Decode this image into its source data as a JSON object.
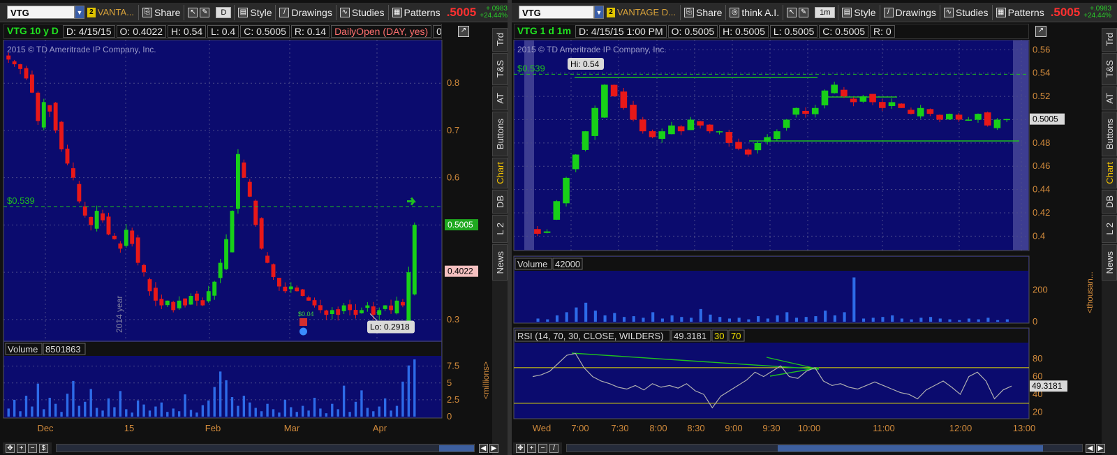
{
  "left": {
    "toolbar": {
      "symbol": "VTG",
      "link_badge": "2",
      "desc": "VANTA...",
      "share": "Share",
      "agg": "D",
      "style": "Style",
      "drawings": "Drawings",
      "studies": "Studies",
      "patterns": "Patterns",
      "last": ".5005",
      "change_abs": "+.0983",
      "change_pct": "+24.44%"
    },
    "header": {
      "symbol": "VTG 10 y D",
      "date": "D: 4/15/15",
      "open": "O: 0.4022",
      "high": "H: 0.54",
      "low": "L: 0.4",
      "close": "C: 0.5005",
      "range": "R: 0.14",
      "study": "DailyOpen (DAY, yes)",
      "study_value": "0.4022"
    },
    "copyright": "2015 © TD Ameritrade IP Company, Inc.",
    "alert_label": "$0.539",
    "hi_lo_label": "Lo: 0.2918",
    "event_label": "$0.04",
    "year_label": "2014 year",
    "price_axis": [
      "0.8",
      "0.7",
      "0.6",
      "0.5",
      "0.4",
      "0.3"
    ],
    "price_tag_last": "0.5005",
    "price_tag_open": "0.4022",
    "volume_label": "Volume",
    "volume_value": "8501863",
    "volume_axis": [
      "7.5",
      "5",
      "2.5",
      "0"
    ],
    "volume_unit": "<millions>",
    "x_axis": [
      "Dec",
      "15",
      "Feb",
      "Mar",
      "Apr"
    ]
  },
  "right": {
    "toolbar": {
      "symbol": "VTG",
      "link_badge": "2",
      "desc": "VANTAGE D...",
      "share": "Share",
      "thinkai": "think A.I.",
      "agg": "1m",
      "style": "Style",
      "drawings": "Drawings",
      "studies": "Studies",
      "patterns": "Patterns",
      "last": ".5005",
      "change_abs": "+.0983",
      "change_pct": "+24.44%"
    },
    "header": {
      "symbol": "VTG 1 d 1m",
      "date": "D: 4/15/15 1:00 PM",
      "open": "O: 0.5005",
      "high": "H: 0.5005",
      "low": "L: 0.5005",
      "close": "C: 0.5005",
      "range": "R: 0"
    },
    "copyright": "2015 © TD Ameritrade IP Company, Inc.",
    "alert_label": "$0.539",
    "hi_label": "Hi: 0.54",
    "price_axis": [
      "0.56",
      "0.54",
      "0.52",
      "0.5",
      "0.48",
      "0.46",
      "0.44",
      "0.42",
      "0.4"
    ],
    "price_tag_last": "0.5005",
    "volume_label": "Volume",
    "volume_value": "42000",
    "volume_axis": [
      "200",
      "0"
    ],
    "volume_unit": "<thousan...",
    "rsi_label": "RSI (14, 70, 30, CLOSE, WILDERS)",
    "rsi_value": "49.3181",
    "rsi_low": "30",
    "rsi_high": "70",
    "rsi_axis": [
      "80",
      "60",
      "40",
      "20"
    ],
    "rsi_tag": "49.3181",
    "x_axis": [
      "Wed",
      "7:00",
      "7:30",
      "8:00",
      "8:30",
      "9:00",
      "9:30",
      "10:00",
      "11:00",
      "12:00",
      "13:00"
    ]
  },
  "sidebar_tabs": [
    "Trd",
    "T&S",
    "AT",
    "Buttons",
    "Chart",
    "DB",
    "L 2",
    "News"
  ],
  "colors": {
    "chart_bg": "#0b0b6e",
    "up": "#18d018",
    "down": "#e81818",
    "alert_line": "#1fc01f",
    "volume": "#2d6be8",
    "rsi": "#b0b0b0",
    "rsi_band": "#e8e000"
  },
  "chart_data": [
    {
      "type": "candlestick",
      "title": "VTG 10 y D",
      "x": [
        "Dec",
        "15",
        "Feb",
        "Mar",
        "Apr"
      ],
      "ylim": [
        0.26,
        0.88
      ],
      "alert_level": 0.539,
      "series": [
        {
          "values": [
            0.85,
            0.84,
            0.83,
            0.81,
            0.78,
            0.72,
            0.76,
            0.74,
            0.7,
            0.66,
            0.63,
            0.6,
            0.55,
            0.52,
            0.5,
            0.53,
            0.51,
            0.48,
            0.47,
            0.45,
            0.49,
            0.46,
            0.42,
            0.4,
            0.36,
            0.34,
            0.33,
            0.34,
            0.32,
            0.34,
            0.33,
            0.35,
            0.34,
            0.33,
            0.36,
            0.38,
            0.42,
            0.47,
            0.53,
            0.65,
            0.6,
            0.56,
            0.5,
            0.45,
            0.42,
            0.39,
            0.37,
            0.36,
            0.37,
            0.36,
            0.35,
            0.34,
            0.33,
            0.32,
            0.31,
            0.32,
            0.31,
            0.33,
            0.32,
            0.31,
            0.32,
            0.33,
            0.31,
            0.32,
            0.33,
            0.32,
            0.34,
            0.33,
            0.4,
            0.5005
          ]
        }
      ]
    },
    {
      "type": "bar",
      "title": "Volume",
      "ylim": [
        0,
        8.5
      ],
      "series": [
        {
          "values": [
            1.2,
            2.5,
            0.8,
            3.1,
            1.5,
            4.9,
            1.1,
            2.8,
            1.9,
            0.7,
            3.4,
            5.3,
            1.6,
            2.2,
            4.1,
            1.3,
            0.9,
            2.7,
            1.4,
            3.8,
            1.1,
            0.6,
            2.4,
            1.8,
            0.9,
            1.5,
            2.1,
            0.7,
            1.2,
            0.8,
            3.3,
            1.0,
            0.6,
            1.7,
            2.4,
            4.4,
            6.7,
            5.4,
            2.9,
            1.6,
            3.1,
            2.1,
            1.3,
            0.8,
            1.9,
            1.1,
            0.6,
            2.5,
            1.4,
            0.7,
            1.6,
            0.9,
            2.8,
            1.2,
            0.5,
            1.9,
            1.1,
            4.6,
            0.7,
            2.2,
            3.9,
            1.3,
            0.8,
            1.5,
            2.7,
            0.9,
            1.6,
            5.2,
            7.6,
            8.5
          ]
        }
      ]
    },
    {
      "type": "candlestick",
      "title": "VTG 1 d 1m",
      "x": [
        "Wed",
        "7:00",
        "7:30",
        "8:00",
        "8:30",
        "9:00",
        "9:30",
        "10:00",
        "11:00",
        "12:00",
        "13:00"
      ],
      "ylim": [
        0.39,
        0.565
      ],
      "alert_level": 0.539,
      "series": [
        {
          "values": [
            0.402,
            0.404,
            0.43,
            0.45,
            0.47,
            0.49,
            0.51,
            0.53,
            0.52,
            0.51,
            0.5,
            0.49,
            0.485,
            0.49,
            0.495,
            0.49,
            0.5,
            0.495,
            0.49,
            0.49,
            0.48,
            0.475,
            0.47,
            0.48,
            0.485,
            0.49,
            0.5,
            0.51,
            0.505,
            0.51,
            0.525,
            0.53,
            0.52,
            0.515,
            0.52,
            0.515,
            0.51,
            0.515,
            0.51,
            0.505,
            0.51,
            0.505,
            0.5,
            0.505,
            0.5,
            0.5,
            0.505,
            0.495,
            0.5,
            0.5005
          ]
        }
      ]
    },
    {
      "type": "bar",
      "title": "Volume",
      "ylim": [
        0,
        300
      ],
      "series": [
        {
          "values": [
            20,
            15,
            40,
            60,
            90,
            120,
            70,
            40,
            55,
            30,
            35,
            25,
            60,
            20,
            40,
            30,
            25,
            80,
            45,
            30,
            20,
            25,
            15,
            35,
            20,
            40,
            60,
            25,
            30,
            35,
            70,
            40,
            60,
            280,
            20,
            25,
            30,
            40,
            20,
            15,
            25,
            30,
            20,
            15,
            10,
            20,
            15,
            25,
            10,
            15
          ]
        }
      ]
    },
    {
      "type": "line",
      "title": "RSI (14, 70, 30, CLOSE, WILDERS)",
      "ylim": [
        15,
        95
      ],
      "series": [
        {
          "values": [
            60,
            62,
            66,
            75,
            84,
            86,
            70,
            60,
            55,
            52,
            48,
            46,
            50,
            45,
            52,
            48,
            50,
            47,
            52,
            44,
            40,
            25,
            38,
            44,
            50,
            56,
            65,
            60,
            66,
            72,
            60,
            58,
            66,
            70,
            55,
            50,
            52,
            48,
            46,
            50,
            54,
            50,
            46,
            42,
            40,
            35,
            45,
            50,
            55,
            48,
            40,
            60,
            65,
            55,
            35,
            45,
            49.3181
          ]
        }
      ]
    }
  ]
}
